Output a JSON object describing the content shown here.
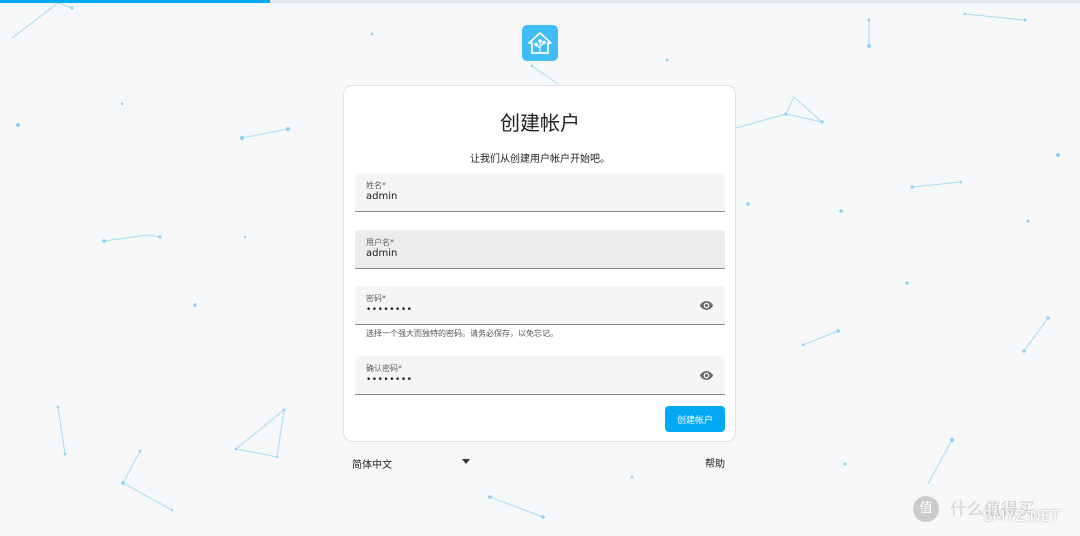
{
  "progress": {
    "fraction": 0.25
  },
  "colors": {
    "accent": "#03a9f4",
    "logo": "#41bdf5",
    "network": "#a7dcf6"
  },
  "logo": {
    "icon": "home-assistant-icon"
  },
  "card": {
    "title": "创建帐户",
    "subtitle": "让我们从创建用户帐户开始吧。",
    "fields": [
      {
        "label": "姓名*",
        "value": "admin"
      },
      {
        "label": "用户名*",
        "value": "admin"
      },
      {
        "label": "密码*",
        "value": "••••••••",
        "helper": "选择一个强大而独特的密码。请务必保存，以免忘记。",
        "icon": "eye-icon"
      },
      {
        "label": "确认密码*",
        "value": "••••••••",
        "icon": "eye-icon"
      }
    ],
    "submit_label": "创建帐户"
  },
  "footer": {
    "language": "简体中文",
    "help": "帮助"
  },
  "watermark": {
    "glyph": "值",
    "text": "SMYZ.NET",
    "faint": "什么值得买"
  }
}
